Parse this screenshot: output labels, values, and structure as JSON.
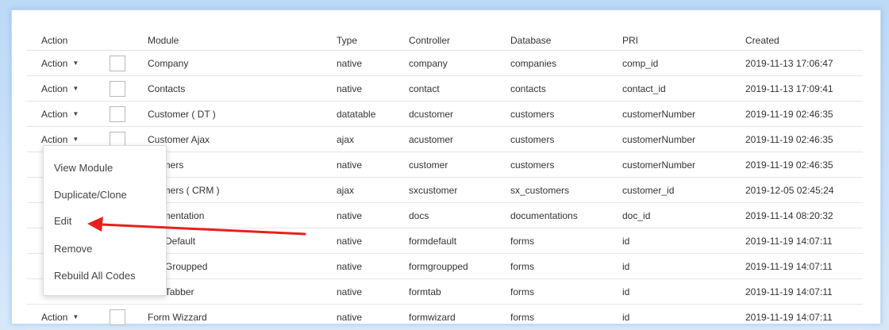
{
  "table": {
    "headers": [
      "Action",
      "Module",
      "Type",
      "Controller",
      "Database",
      "PRI",
      "Created"
    ],
    "action_label": "Action",
    "rows": [
      {
        "module": "Company",
        "type": "native",
        "controller": "company",
        "database": "companies",
        "pri": "comp_id",
        "created": "2019-11-13 17:06:47"
      },
      {
        "module": "Contacts",
        "type": "native",
        "controller": "contact",
        "database": "contacts",
        "pri": "contact_id",
        "created": "2019-11-13 17:09:41"
      },
      {
        "module": "Customer ( DT )",
        "type": "datatable",
        "controller": "dcustomer",
        "database": "customers",
        "pri": "customerNumber",
        "created": "2019-11-19 02:46:35"
      },
      {
        "module": "Customer Ajax",
        "type": "ajax",
        "controller": "acustomer",
        "database": "customers",
        "pri": "customerNumber",
        "created": "2019-11-19 02:46:35"
      },
      {
        "module": "omers",
        "type": "native",
        "controller": "customer",
        "database": "customers",
        "pri": "customerNumber",
        "created": "2019-11-19 02:46:35"
      },
      {
        "module": "omers ( CRM )",
        "type": "ajax",
        "controller": "sxcustomer",
        "database": "sx_customers",
        "pri": "customer_id",
        "created": "2019-12-05 02:45:24"
      },
      {
        "module": "umentation",
        "type": "native",
        "controller": "docs",
        "database": "documentations",
        "pri": "doc_id",
        "created": "2019-11-14 08:20:32"
      },
      {
        "module": "n Default",
        "type": "native",
        "controller": "formdefault",
        "database": "forms",
        "pri": "id",
        "created": "2019-11-19 14:07:11"
      },
      {
        "module": "n Groupped",
        "type": "native",
        "controller": "formgroupped",
        "database": "forms",
        "pri": "id",
        "created": "2019-11-19 14:07:11"
      },
      {
        "module": "n Tabber",
        "type": "native",
        "controller": "formtab",
        "database": "forms",
        "pri": "id",
        "created": "2019-11-19 14:07:11"
      },
      {
        "module": "Form Wizzard",
        "type": "native",
        "controller": "formwizard",
        "database": "forms",
        "pri": "id",
        "created": "2019-11-19 14:07:11"
      }
    ]
  },
  "dropdown": {
    "items": [
      "View Module",
      "Duplicate/Clone",
      "Edit",
      "Remove",
      "Rebuild All Codes"
    ]
  },
  "colors": {
    "annotation_arrow": "#e8201c",
    "frame_glow": "#bcd9f6"
  }
}
